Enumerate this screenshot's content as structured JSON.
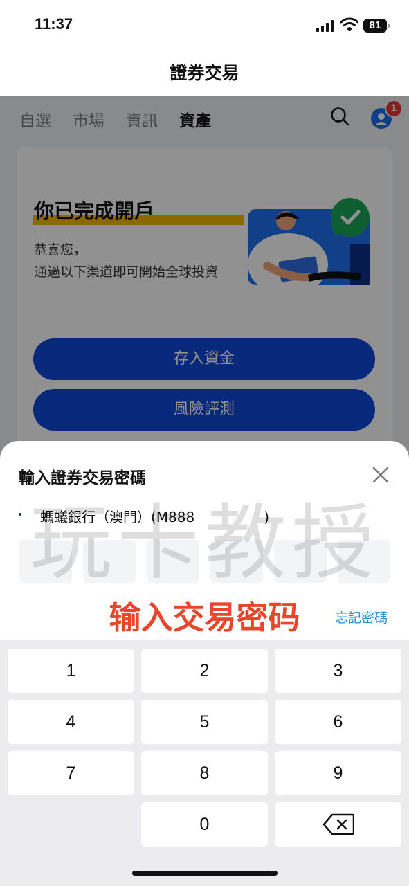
{
  "status_bar": {
    "time": "11:37",
    "battery": "81"
  },
  "nav": {
    "title": "證券交易"
  },
  "tabs": [
    "自選",
    "市場",
    "資訊",
    "資產"
  ],
  "active_tab": "資產",
  "notification_count": "1",
  "card": {
    "title": "你已完成開戶",
    "sub1": "恭喜您，",
    "sub2": "通過以下渠道即可開始全球投資"
  },
  "buttons": {
    "deposit": "存入資金",
    "risk": "風險評測"
  },
  "sheet": {
    "title": "輸入證券交易密碼",
    "bank_logo": "ANT BANK",
    "account": "螞蟻銀行（澳門）(M888　　　　　)",
    "forgot": "忘記密碼",
    "watermark": "玩卡教授",
    "caption": "输入交易密码"
  },
  "keypad": {
    "k1": "1",
    "k2": "2",
    "k3": "3",
    "k4": "4",
    "k5": "5",
    "k6": "6",
    "k7": "7",
    "k8": "8",
    "k9": "9",
    "k0": "0"
  },
  "colors": {
    "primary": "#0d47d8",
    "highlight": "#f5b800",
    "caption": "#e8462b",
    "link": "#2f8fd8"
  }
}
